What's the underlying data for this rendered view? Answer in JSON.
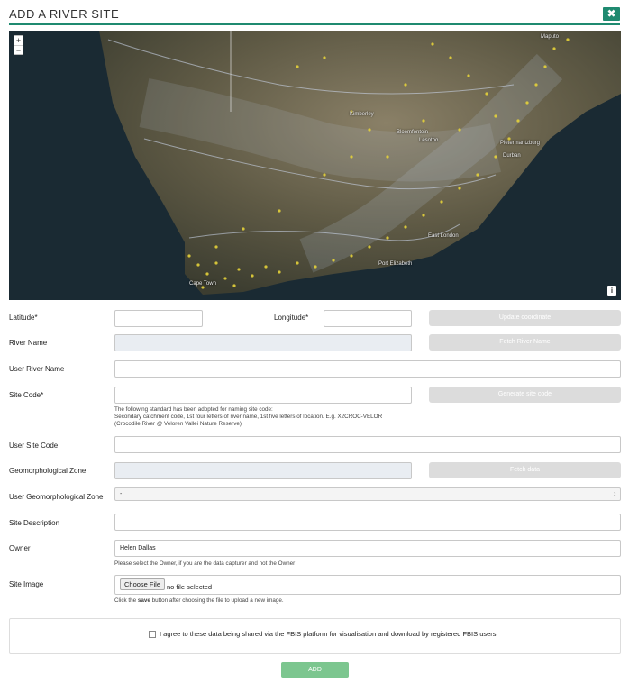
{
  "header": {
    "title": "ADD A RIVER SITE",
    "close_glyph": "✖"
  },
  "map": {
    "zoom_in": "+",
    "zoom_out": "−",
    "info_glyph": "i",
    "place_labels": [
      "Maputo",
      "Kimberley",
      "Bloemfontein",
      "Pietermaritzburg",
      "Durban",
      "Lesotho",
      "East London",
      "Port Elizabeth",
      "Cape Town"
    ]
  },
  "form": {
    "latitude_label": "Latitude*",
    "latitude_value": "",
    "longitude_label": "Longitude*",
    "longitude_value": "",
    "update_coords_button": "Update coordinate",
    "river_name_label": "River Name",
    "river_name_value": "",
    "fetch_river_button": "Fetch River Name",
    "user_river_name_label": "User River Name",
    "user_river_name_value": "",
    "site_code_label": "Site Code*",
    "site_code_value": "",
    "generate_code_button": "Generate site code",
    "site_code_help_1": "The following standard has been adopted for naming site code:",
    "site_code_help_2": "Secondary catchment code, 1st four letters of river name, 1st five letters of location. E.g. X2CROC-VELOR",
    "site_code_help_3": "(Crocodile River @ Veloren Vallei Nature Reserve)",
    "user_site_code_label": "User Site Code",
    "user_site_code_value": "",
    "geomorph_label": "Geomorphological Zone",
    "geomorph_value": "",
    "fetch_data_button": "Fetch data",
    "user_geomorph_label": "User Geomorphological Zone",
    "user_geomorph_selected": "-",
    "select_arrow": "↕",
    "site_desc_label": "Site Description",
    "site_desc_value": "",
    "owner_label": "Owner",
    "owner_value": "Helen Dallas",
    "owner_help": "Please select the Owner, if you are the data capturer and not the Owner",
    "site_image_label": "Site Image",
    "choose_file_button": "Choose File",
    "no_file_text": "no file selected",
    "image_help_pre": "Click the ",
    "image_help_bold": "save",
    "image_help_post": " button after choosing the file to upload a new image.",
    "agree_text": "I agree to these data being shared via the FBIS platform for visualisation and download by registered FBIS users",
    "add_button": "ADD"
  },
  "colors": {
    "accent": "#1f8a70",
    "add_button": "#7cc68f",
    "disabled_button": "#dcdcdc",
    "site_marker": "#e5d23a"
  }
}
